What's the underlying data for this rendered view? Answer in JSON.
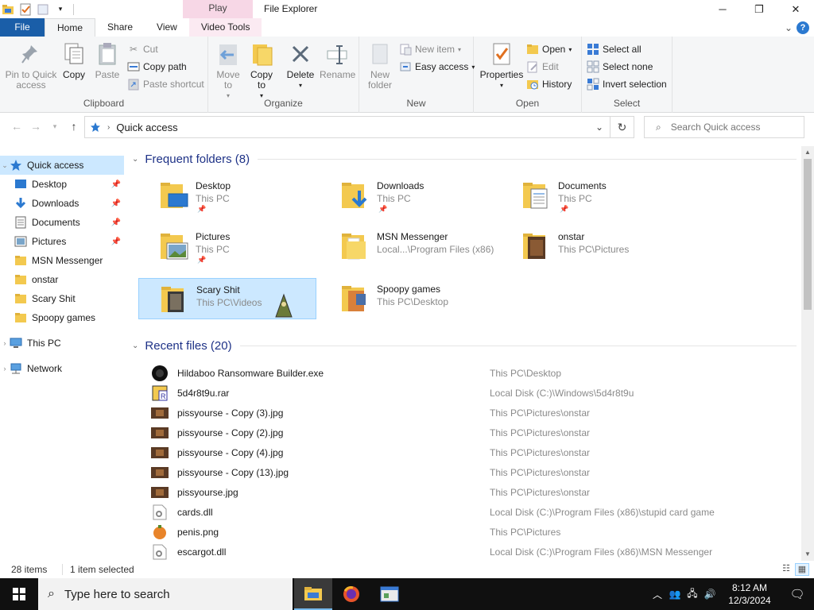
{
  "window": {
    "title": "File Explorer",
    "context_tab_header": "Play",
    "minimize": "─",
    "maximize": "❐",
    "close": "✕"
  },
  "ribbon_tabs": {
    "file": "File",
    "home": "Home",
    "share": "Share",
    "view": "View",
    "video_tools": "Video Tools",
    "collapse": "⌄",
    "help": "?"
  },
  "ribbon": {
    "clipboard": {
      "label": "Clipboard",
      "pin": "Pin to Quick access",
      "copy": "Copy",
      "paste": "Paste",
      "cut": "Cut",
      "copy_path": "Copy path",
      "paste_shortcut": "Paste shortcut"
    },
    "organize": {
      "label": "Organize",
      "move_to": "Move to",
      "copy_to": "Copy to",
      "delete": "Delete",
      "rename": "Rename"
    },
    "new": {
      "label": "New",
      "new_folder": "New folder",
      "new_item": "New item",
      "easy_access": "Easy access"
    },
    "open": {
      "label": "Open",
      "properties": "Properties",
      "open": "Open",
      "edit": "Edit",
      "history": "History"
    },
    "select": {
      "label": "Select",
      "select_all": "Select all",
      "select_none": "Select none",
      "invert": "Invert selection"
    }
  },
  "address": {
    "path": "Quick access",
    "search_placeholder": "Search Quick access"
  },
  "nav_pane": {
    "items": [
      {
        "label": "Quick access",
        "pinned": false
      },
      {
        "label": "Desktop",
        "pinned": true
      },
      {
        "label": "Downloads",
        "pinned": true
      },
      {
        "label": "Documents",
        "pinned": true
      },
      {
        "label": "Pictures",
        "pinned": true
      },
      {
        "label": "MSN Messenger",
        "pinned": false
      },
      {
        "label": "onstar",
        "pinned": false
      },
      {
        "label": "Scary Shit",
        "pinned": false
      },
      {
        "label": "Spoopy games",
        "pinned": false
      },
      {
        "label": "This PC",
        "pinned": false
      },
      {
        "label": "Network",
        "pinned": false
      }
    ]
  },
  "frequent": {
    "header": "Frequent folders (8)",
    "folders": [
      {
        "name": "Desktop",
        "location": "This PC",
        "pinned": true
      },
      {
        "name": "Downloads",
        "location": "This PC",
        "pinned": true
      },
      {
        "name": "Documents",
        "location": "This PC",
        "pinned": true
      },
      {
        "name": "Pictures",
        "location": "This PC",
        "pinned": true
      },
      {
        "name": "MSN Messenger",
        "location": "Local...\\Program Files (x86)",
        "pinned": false
      },
      {
        "name": "onstar",
        "location": "This PC\\Pictures",
        "pinned": false
      },
      {
        "name": "Scary Shit",
        "location": "This PC\\Videos",
        "pinned": false
      },
      {
        "name": "Spoopy games",
        "location": "This PC\\Desktop",
        "pinned": false
      }
    ]
  },
  "recent": {
    "header": "Recent files (20)",
    "files": [
      {
        "name": "Hildaboo Ransomware Builder.exe",
        "location": "This PC\\Desktop"
      },
      {
        "name": "5d4r8t9u.rar",
        "location": "Local Disk (C:)\\Windows\\5d4r8t9u"
      },
      {
        "name": "pissyourse - Copy (3).jpg",
        "location": "This PC\\Pictures\\onstar"
      },
      {
        "name": "pissyourse - Copy (2).jpg",
        "location": "This PC\\Pictures\\onstar"
      },
      {
        "name": "pissyourse - Copy (4).jpg",
        "location": "This PC\\Pictures\\onstar"
      },
      {
        "name": "pissyourse - Copy (13).jpg",
        "location": "This PC\\Pictures\\onstar"
      },
      {
        "name": "pissyourse.jpg",
        "location": "This PC\\Pictures\\onstar"
      },
      {
        "name": "cards.dll",
        "location": "Local Disk (C:)\\Program Files (x86)\\stupid card game"
      },
      {
        "name": "penis.png",
        "location": "This PC\\Pictures"
      },
      {
        "name": "escargot.dll",
        "location": "Local Disk (C:)\\Program Files (x86)\\MSN Messenger"
      }
    ]
  },
  "status": {
    "items": "28 items",
    "selected": "1 item selected"
  },
  "taskbar": {
    "search_placeholder": "Type here to search",
    "time": "8:12 AM",
    "date": "12/3/2024"
  },
  "colors": {
    "file_tab": "#1a5ea8",
    "selection": "#cce8ff",
    "section_header": "#1e3287",
    "context_tab": "#f7d7e6",
    "folder_yellow": "#f3c94f"
  }
}
